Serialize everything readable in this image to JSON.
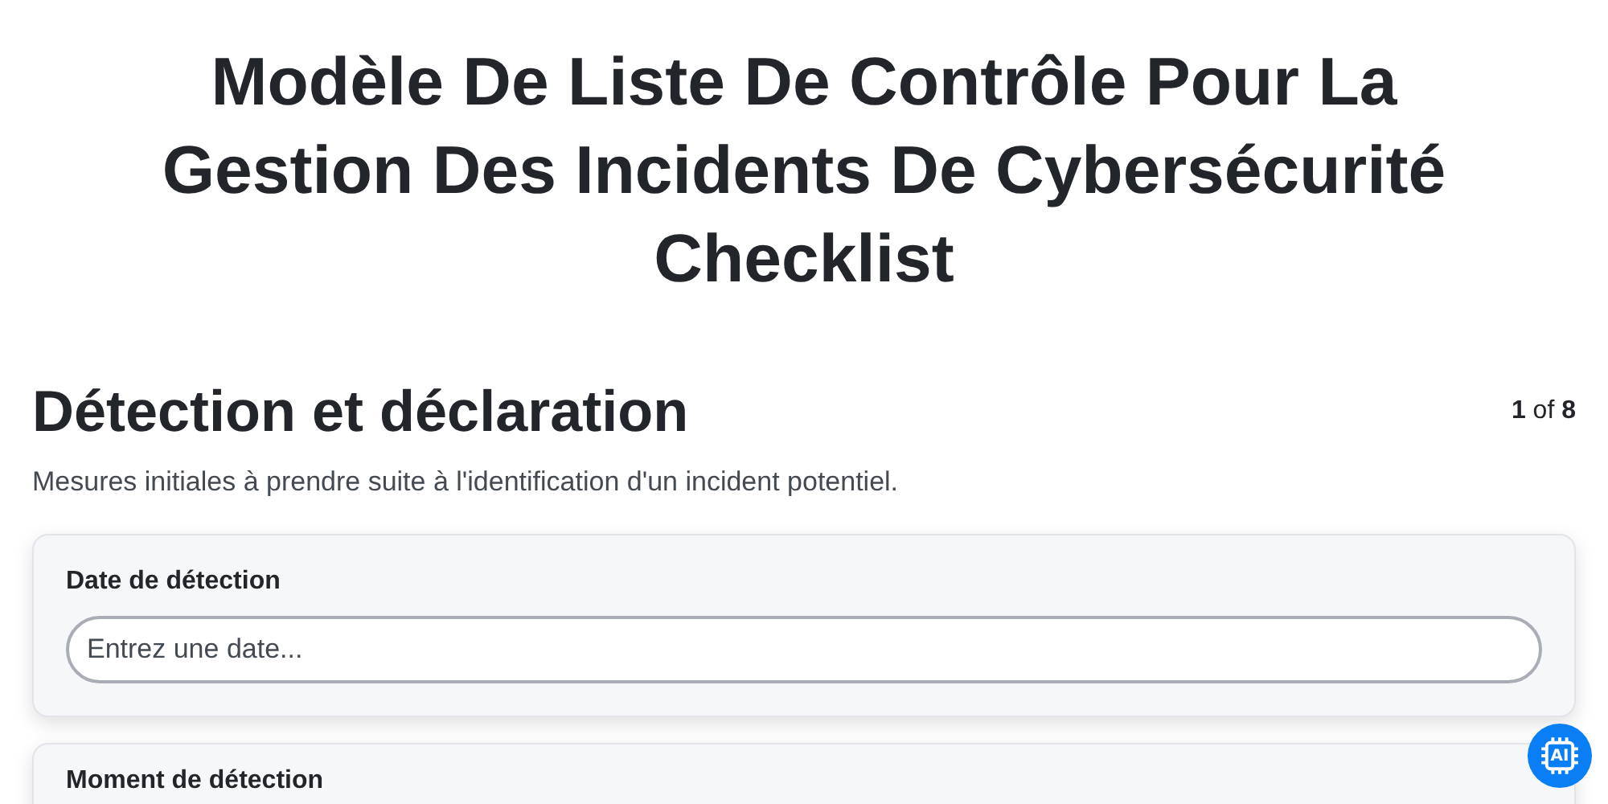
{
  "title": "Modèle De Liste De Contrôle Pour La Gestion Des Incidents De Cybersécurité Checklist",
  "section": {
    "heading": "Détection et déclaration",
    "pager": "**1** of **8**",
    "description": "Mesures initiales à prendre suite à l'identification d'un incident potentiel."
  },
  "fields": [
    {
      "label": "Date de détection",
      "placeholder": "Entrez une date..."
    },
    {
      "label": "Moment de détection"
    }
  ],
  "ai_button": {
    "label": "AI"
  }
}
